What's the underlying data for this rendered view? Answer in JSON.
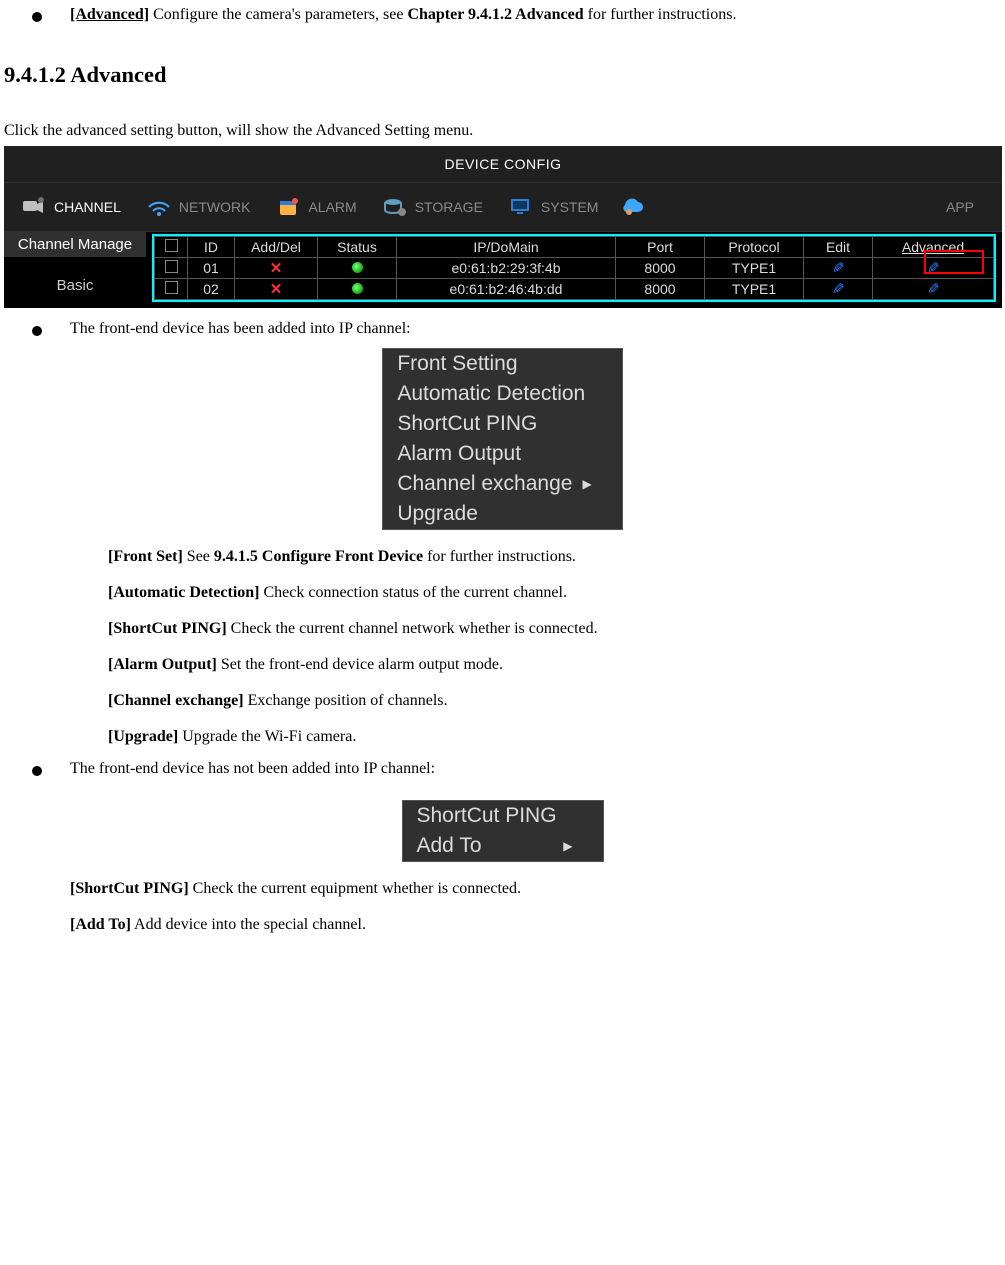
{
  "intro_bullet": {
    "label": "[Advanced]",
    "text": " Configure the camera's parameters, see ",
    "ref": "Chapter 9.4.1.2 Advanced",
    "tail": " for further instructions."
  },
  "section_heading": "9.4.1.2 Advanced",
  "intro_line": "Click the advanced setting button, will show the Advanced Setting menu.",
  "device_config": {
    "title": "DEVICE CONFIG",
    "tabs": {
      "channel": "CHANNEL",
      "network": "NETWORK",
      "alarm": "ALARM",
      "storage": "STORAGE",
      "system": "SYSTEM",
      "app": "APP"
    },
    "sidebar": {
      "channel_manage": "Channel Manage",
      "basic": "Basic"
    },
    "headers": {
      "id": "ID",
      "adddel": "Add/Del",
      "status": "Status",
      "ipdomain": "IP/DoMain",
      "port": "Port",
      "protocol": "Protocol",
      "edit": "Edit",
      "advanced": "Advanced"
    },
    "rows": [
      {
        "id": "01",
        "ip": "e0:61:b2:29:3f:4b",
        "port": "8000",
        "protocol": "TYPE1"
      },
      {
        "id": "02",
        "ip": "e0:61:b2:46:4b:dd",
        "port": "8000",
        "protocol": "TYPE1"
      }
    ]
  },
  "added_bullet": "The front-end device has been added into IP channel:",
  "menu1": {
    "front_setting": "Front Setting",
    "auto_detect": "Automatic Detection",
    "shortcut_ping": "ShortCut PING",
    "alarm_output": "Alarm Output",
    "channel_exchange": "Channel exchange",
    "upgrade": "Upgrade"
  },
  "desc": {
    "front_set_label": "[Front Set]",
    "front_set_text": " See ",
    "front_set_ref": "9.4.1.5 Configure Front Device",
    "front_set_tail": " for further instructions.",
    "auto_label": "[Automatic Detection]",
    "auto_text": " Check connection status of the current channel.",
    "ping_label": "[ShortCut PING]",
    "ping_text": " Check the current channel network whether is connected.",
    "alarm_label": "[Alarm Output]",
    "alarm_text": " Set the front-end device alarm output mode.",
    "chex_label": "[Channel exchange]",
    "chex_text": " Exchange position of channels.",
    "upg_label": "[Upgrade]",
    "upg_text": " Upgrade the Wi-Fi camera."
  },
  "not_added_bullet": "The front-end device has not been added into IP channel:",
  "menu2": {
    "shortcut_ping": "ShortCut PING",
    "add_to": "Add To"
  },
  "desc2": {
    "ping_label": "[ShortCut PING]",
    "ping_text": " Check the current equipment whether is connected.",
    "addto_label": "[Add To]",
    "addto_text": " Add device into the special channel."
  }
}
